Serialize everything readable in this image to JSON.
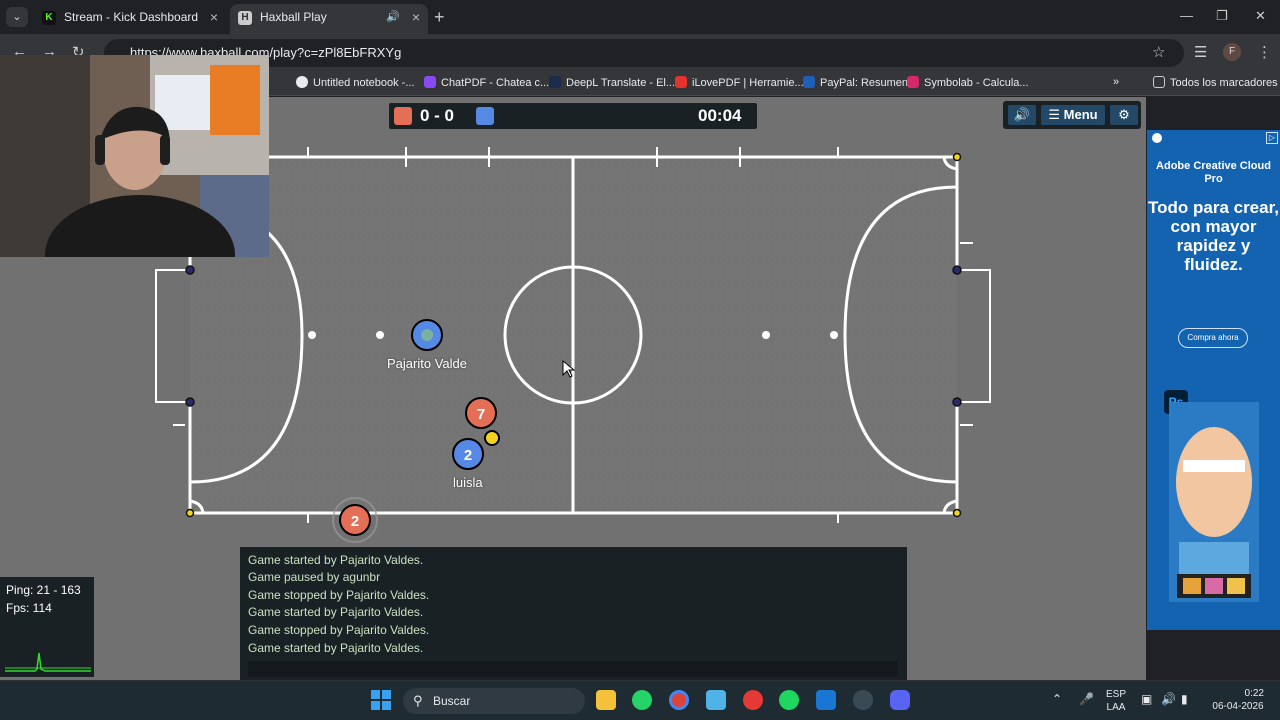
{
  "browser": {
    "tabs": [
      {
        "label": "Stream - Kick Dashboard",
        "icon": "kick-icon",
        "active": false
      },
      {
        "label": "Haxball Play",
        "icon": "haxball-icon",
        "active": true
      }
    ],
    "url": "https://www.haxball.com/play?c=zPl8EbFRXYg",
    "profile_initial": "F",
    "bookmarks": [
      {
        "label": "Untitled notebook -...",
        "color": "#e8eaed"
      },
      {
        "label": "ChatPDF - Chatea c...",
        "color": "#8a4af3"
      },
      {
        "label": "DeepL Translate - El...",
        "color": "#1b2c4b"
      },
      {
        "label": "iLovePDF | Herramie...",
        "color": "#e5322d"
      },
      {
        "label": "PayPal: Resumen",
        "color": "#1e5fb8"
      },
      {
        "label": "Symbolab - Calcula...",
        "color": "#d6286b"
      }
    ],
    "all_bookmarks": "Todos los marcadores"
  },
  "game": {
    "score": "0 - 0",
    "timer": "00:04",
    "red_color": "#e56e56",
    "blue_color": "#5689e5",
    "menu_label": "Menu",
    "players": [
      {
        "name": "Pajarito Valde",
        "team": "blue",
        "number": ""
      },
      {
        "name": "",
        "team": "red",
        "number": "7"
      },
      {
        "name": "luisla",
        "team": "blue",
        "number": "2"
      },
      {
        "name": "",
        "team": "red",
        "number": "2"
      }
    ]
  },
  "chat": {
    "messages": [
      "Game started by Pajarito Valdes.",
      "Game paused by agunbr",
      "Game stopped by Pajarito Valdes.",
      "Game started by Pajarito Valdes.",
      "Game stopped by Pajarito Valdes.",
      "Game started by Pajarito Valdes."
    ]
  },
  "stats": {
    "ping": "Ping: 21 - 163",
    "fps": "Fps: 114"
  },
  "ad": {
    "brand": "Adobe Creative Cloud Pro",
    "headline": "Todo para crear, con mayor rapidez y fluidez.",
    "cta": "Compra ahora",
    "ps_label": "Ps"
  },
  "taskbar": {
    "search_placeholder": "Buscar",
    "lang_top": "ESP",
    "lang_bottom": "LAA",
    "time": "0:22",
    "date": "06-04-2026"
  }
}
